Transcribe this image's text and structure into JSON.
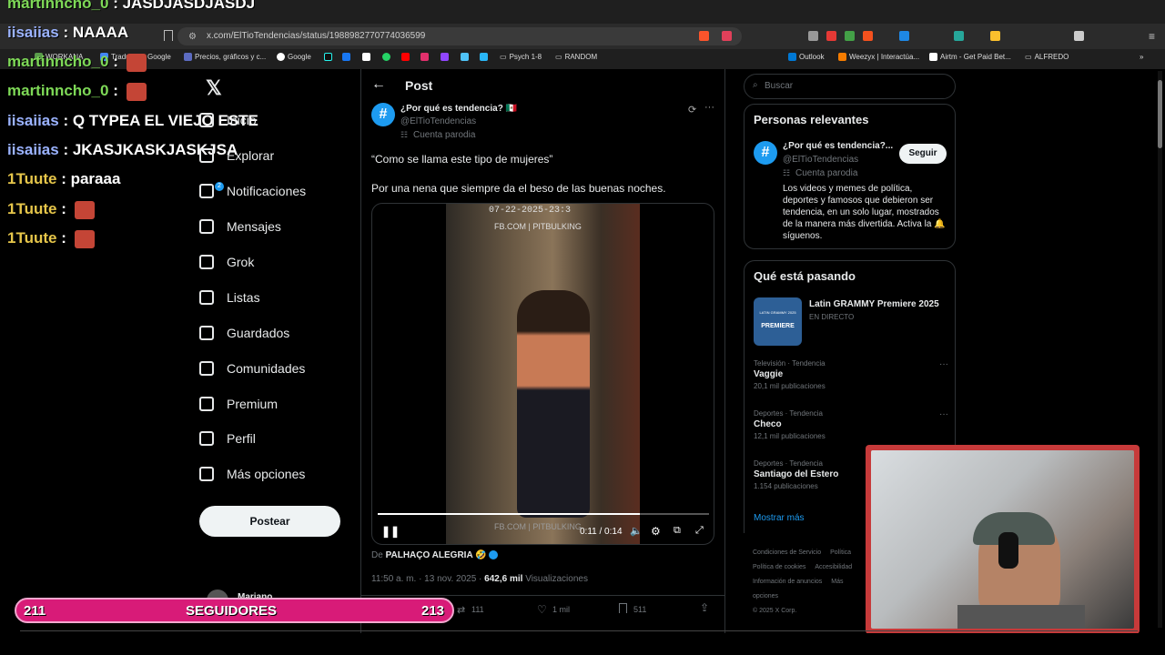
{
  "browser": {
    "url": "x.com/ElTioTendencias/status/1988982770774036599",
    "bookmarks": [
      "WORKANA",
      "Traducir",
      "Google",
      "Precios, gráficos y c...",
      "Google",
      "Psych 1-8",
      "RANDOM",
      "Outlook",
      "Weezyx | Interactúa...",
      "Airtm - Get Paid Bet...",
      "ALFREDO"
    ]
  },
  "chat": [
    {
      "user": "martinncho_0",
      "msg": "JASDJASDJASDJ",
      "color": "green",
      "emote": false
    },
    {
      "user": "iisaiias",
      "msg": "NAAAA",
      "color": "blue",
      "emote": false
    },
    {
      "user": "martinncho_0",
      "msg": "",
      "color": "green",
      "emote": true
    },
    {
      "user": "martinncho_0",
      "msg": "",
      "color": "green",
      "emote": true
    },
    {
      "user": "iisaiias",
      "msg": "Q TYPEA EL VIEJO ESTE",
      "color": "blue",
      "emote": false
    },
    {
      "user": "iisaiias",
      "msg": "JKASJKASKJASKJSA",
      "color": "blue",
      "emote": false
    },
    {
      "user": "1Tuute",
      "msg": "paraaa",
      "color": "yellow",
      "emote": false
    },
    {
      "user": "1Tuute",
      "msg": "",
      "color": "yellow",
      "emote": true
    },
    {
      "user": "1Tuute",
      "msg": "",
      "color": "yellow",
      "emote": true
    }
  ],
  "nav": [
    "Inicio",
    "Explorar",
    "Notificaciones",
    "Mensajes",
    "Grok",
    "Listas",
    "Guardados",
    "Comunidades",
    "Premium",
    "Perfil",
    "Más opciones"
  ],
  "nav_badge": "2",
  "post_button": "Postear",
  "profile_name_partial": "Mariano",
  "post": {
    "header": "Post",
    "author_name": "¿Por qué es tendencia? 🇲🇽",
    "handle": "@ElTioTendencias",
    "parody": "Cuenta parodia",
    "text1": "“Como se llama este tipo de mujeres”",
    "text2": "Por una nena que siempre da el beso de las buenas noches.",
    "video_stamp": "07-22-2025-23:3",
    "video_watermark": "FB.COM | PITBULKING",
    "video_watermark_bottom": "FB.COM | PITBULKING",
    "video_time": "0:11 / 0:14",
    "video_progress": 0.79,
    "from_prefix": "De",
    "from_account": "PALHAÇO ALEGRIA 🤣",
    "time": "11:50 a. m. · 13 nov. 2025 ·",
    "views": "642,6 mil",
    "views_label": "Visualizaciones",
    "retweets": "111",
    "likes": "1 mil",
    "bookmarks": "511"
  },
  "search": {
    "placeholder": "Buscar"
  },
  "relevant": {
    "title": "Personas relevantes",
    "name": "¿Por qué es tendencia?...",
    "handle": "@ElTioTendencias",
    "parody": "Cuenta parodia",
    "follow": "Seguir",
    "bio": "Los videos y memes de política, deportes y famosos que debieron ser tendencia, en un solo lugar, mostrados de la manera más divertida. Activa la 🔔 síguenos."
  },
  "happening": {
    "title": "Qué está pasando",
    "event": "Latin GRAMMY Premiere 2025",
    "event_status": "EN DIRECTO",
    "event_thumb_top": "LATIN GRAMMY 2025",
    "event_thumb": "PREMIERE",
    "trends": [
      {
        "cat": "Televisión · Tendencia",
        "name": "Vaggie",
        "count": "20,1 mil publicaciones"
      },
      {
        "cat": "Deportes · Tendencia",
        "name": "Checo",
        "count": "12,1 mil publicaciones"
      },
      {
        "cat": "Deportes · Tendencia",
        "name": "Santiago del Estero",
        "count": "1.154 publicaciones"
      }
    ],
    "more": "Mostrar más"
  },
  "footer_links": [
    "Condiciones de Servicio",
    "Política",
    "Política de cookies",
    "Accesibilidad",
    "Información de anuncios",
    "Más opciones",
    "© 2025 X Corp."
  ],
  "followers_bar": {
    "left": "211",
    "label": "SEGUIDORES",
    "right": "213"
  },
  "colors": {
    "accent": "#1d9bf0",
    "bar": "#d81b78",
    "webcam_frame": "#c73a3a"
  }
}
